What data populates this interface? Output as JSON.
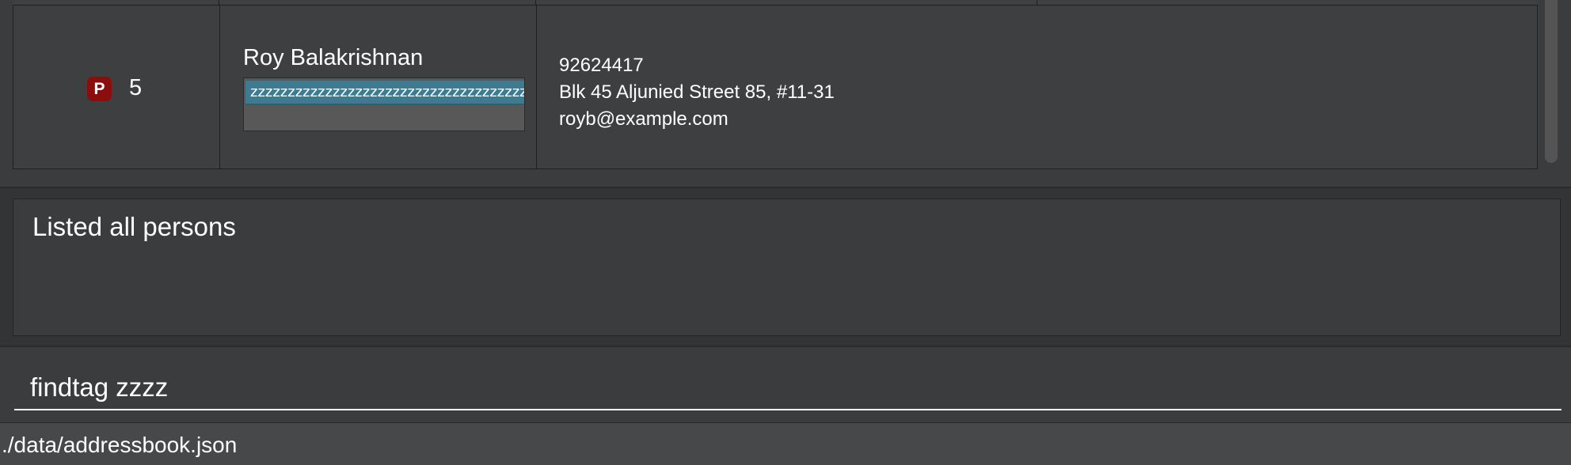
{
  "person_list": {
    "persons": [
      {
        "priority_badge": "P",
        "index": "5",
        "name": "Roy Balakrishnan",
        "tags": [
          "zzzzzzzzzzzzzzzzzzzzzzzzzzzzzzzzzzzzzzzzzzz"
        ],
        "phone": "92624417",
        "address": "Blk 45 Aljunied Street 85, #11-31",
        "email": "royb@example.com"
      }
    ]
  },
  "result_display": {
    "message": "Listed all persons"
  },
  "command_box": {
    "value": "findtag zzzz"
  },
  "status_bar": {
    "save_location": "./data/addressbook.json"
  },
  "colors": {
    "background": "#333435",
    "panel": "#3b3c3e",
    "priority_badge": "#8b0e0e",
    "tag": "#3e7b91",
    "text": "#ffffff"
  }
}
